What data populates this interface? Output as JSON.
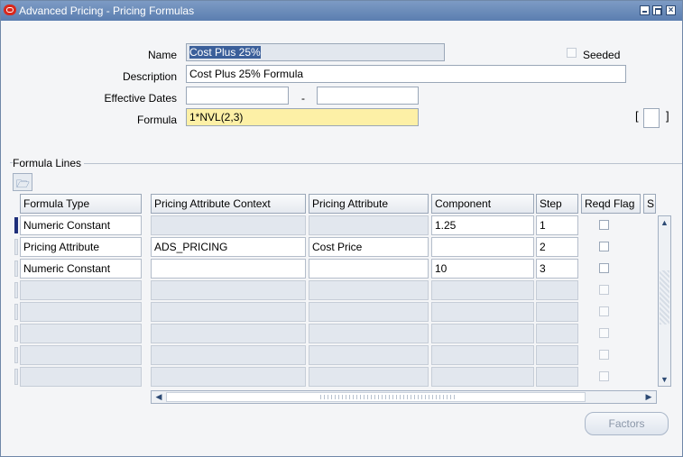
{
  "window": {
    "title": "Advanced Pricing - Pricing Formulas"
  },
  "header": {
    "name_label": "Name",
    "name_value": "Cost Plus 25%",
    "seeded_label": "Seeded",
    "description_label": "Description",
    "description_value": "Cost Plus 25% Formula",
    "effective_dates_label": "Effective Dates",
    "date_from": "",
    "date_separator": "-",
    "date_to": "",
    "formula_label": "Formula",
    "formula_value": "1*NVL(2,3)",
    "bracket_open": "[",
    "bracket_close": "]"
  },
  "formula_lines": {
    "section_title": "Formula Lines",
    "columns": [
      "Formula Type",
      "Pricing Attribute Context",
      "Pricing Attribute",
      "Component",
      "Step",
      "Reqd Flag",
      "S"
    ],
    "rows": [
      {
        "formula_type": "Numeric Constant",
        "context": "",
        "attribute": "",
        "component": "1.25",
        "step": "1"
      },
      {
        "formula_type": "Pricing Attribute",
        "context": "ADS_PRICING",
        "attribute": "Cost Price",
        "component": "",
        "step": "2"
      },
      {
        "formula_type": "Numeric Constant",
        "context": "",
        "attribute": "",
        "component": "10",
        "step": "3"
      }
    ]
  },
  "buttons": {
    "factors": "Factors"
  },
  "icons": {
    "folder": "folder-open-icon",
    "logo": "oracle-logo-icon"
  }
}
